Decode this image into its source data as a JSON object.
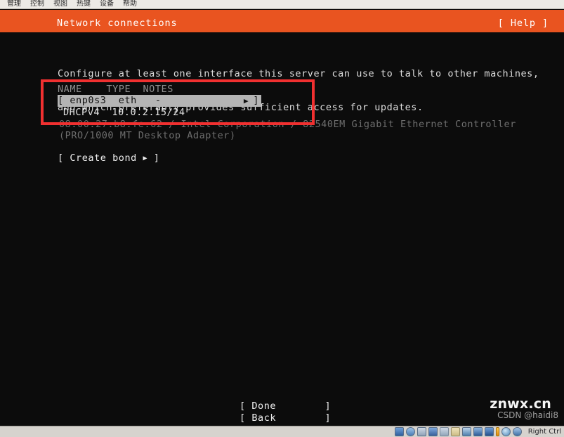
{
  "window": {
    "menubar": [
      {
        "label": "管理",
        "name": "menu-manage"
      },
      {
        "label": "控制",
        "name": "menu-machine"
      },
      {
        "label": "视图",
        "name": "menu-view"
      },
      {
        "label": "热键",
        "name": "menu-input"
      },
      {
        "label": "设备",
        "name": "menu-devices"
      },
      {
        "label": "帮助",
        "name": "menu-help"
      }
    ]
  },
  "header": {
    "title": "Network connections",
    "help_label": "[ Help ]",
    "background_color": "#e95420",
    "text_color": "#ffffff"
  },
  "description": {
    "line1": "Configure at least one interface this server can use to talk to other machines,",
    "line2": "and which preferably provides sufficient access for updates."
  },
  "interfaces": {
    "columns": "NAME    TYPE  NOTES",
    "selected_row": {
      "open_bracket": "[",
      "name": "enp0s3",
      "type": "eth",
      "notes": "-",
      "arrow": "▶",
      "close_bracket": "]",
      "row_text": "[ enp0s3  eth   -",
      "highlight_color": "#b4b4b4",
      "text_color": "#101010"
    },
    "address_row": "DHCPv4  10.0.2.15/24",
    "detail_line1": "08:00:27:b8:fe:62 / Intel Corporation / 82540EM Gigabit Ethernet Controller",
    "detail_line2": "(PRO/1000 MT Desktop Adapter)"
  },
  "actions": {
    "create_bond_open": "[ Create bond ",
    "create_bond_arrow": "▶",
    "create_bond_close": " ]",
    "done": "[ Done        ]",
    "back": "[ Back        ]"
  },
  "annotation": {
    "color": "#f03030"
  },
  "watermarks": {
    "main": "znwx.cn",
    "sub": "CSDN @haidi8"
  },
  "statusbar": {
    "host_key": "Right Ctrl",
    "icons": [
      "hard-disk-icon",
      "optical-drive-icon",
      "floppy-drive-icon",
      "network-icon",
      "usb-icon",
      "shared-folder-icon",
      "display-icon",
      "recording-icon",
      "features-icon",
      "activity-bar-icon",
      "mouse-icon",
      "host-key-icon"
    ]
  }
}
